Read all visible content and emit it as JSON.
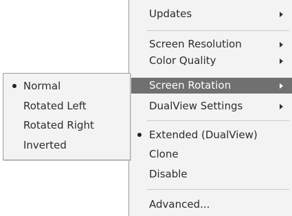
{
  "main_menu": {
    "items": [
      {
        "label": "Updates"
      },
      {
        "label": "Screen Resolution"
      },
      {
        "label": "Color Quality"
      },
      {
        "label": "Screen Rotation"
      },
      {
        "label": "DualView Settings"
      },
      {
        "label": "Extended (DualView)"
      },
      {
        "label": "Clone"
      },
      {
        "label": "Disable"
      },
      {
        "label": "Advanced..."
      }
    ],
    "highlighted_item": "Screen Rotation",
    "selected_mode": "Extended (DualView)"
  },
  "rotation_submenu": {
    "items": [
      {
        "label": "Normal"
      },
      {
        "label": "Rotated Left"
      },
      {
        "label": "Rotated Right"
      },
      {
        "label": "Inverted"
      }
    ],
    "selected": "Normal"
  },
  "colors": {
    "menu_background": "#f3f3f3",
    "highlight": "#707070",
    "border": "#9a9a9a"
  }
}
